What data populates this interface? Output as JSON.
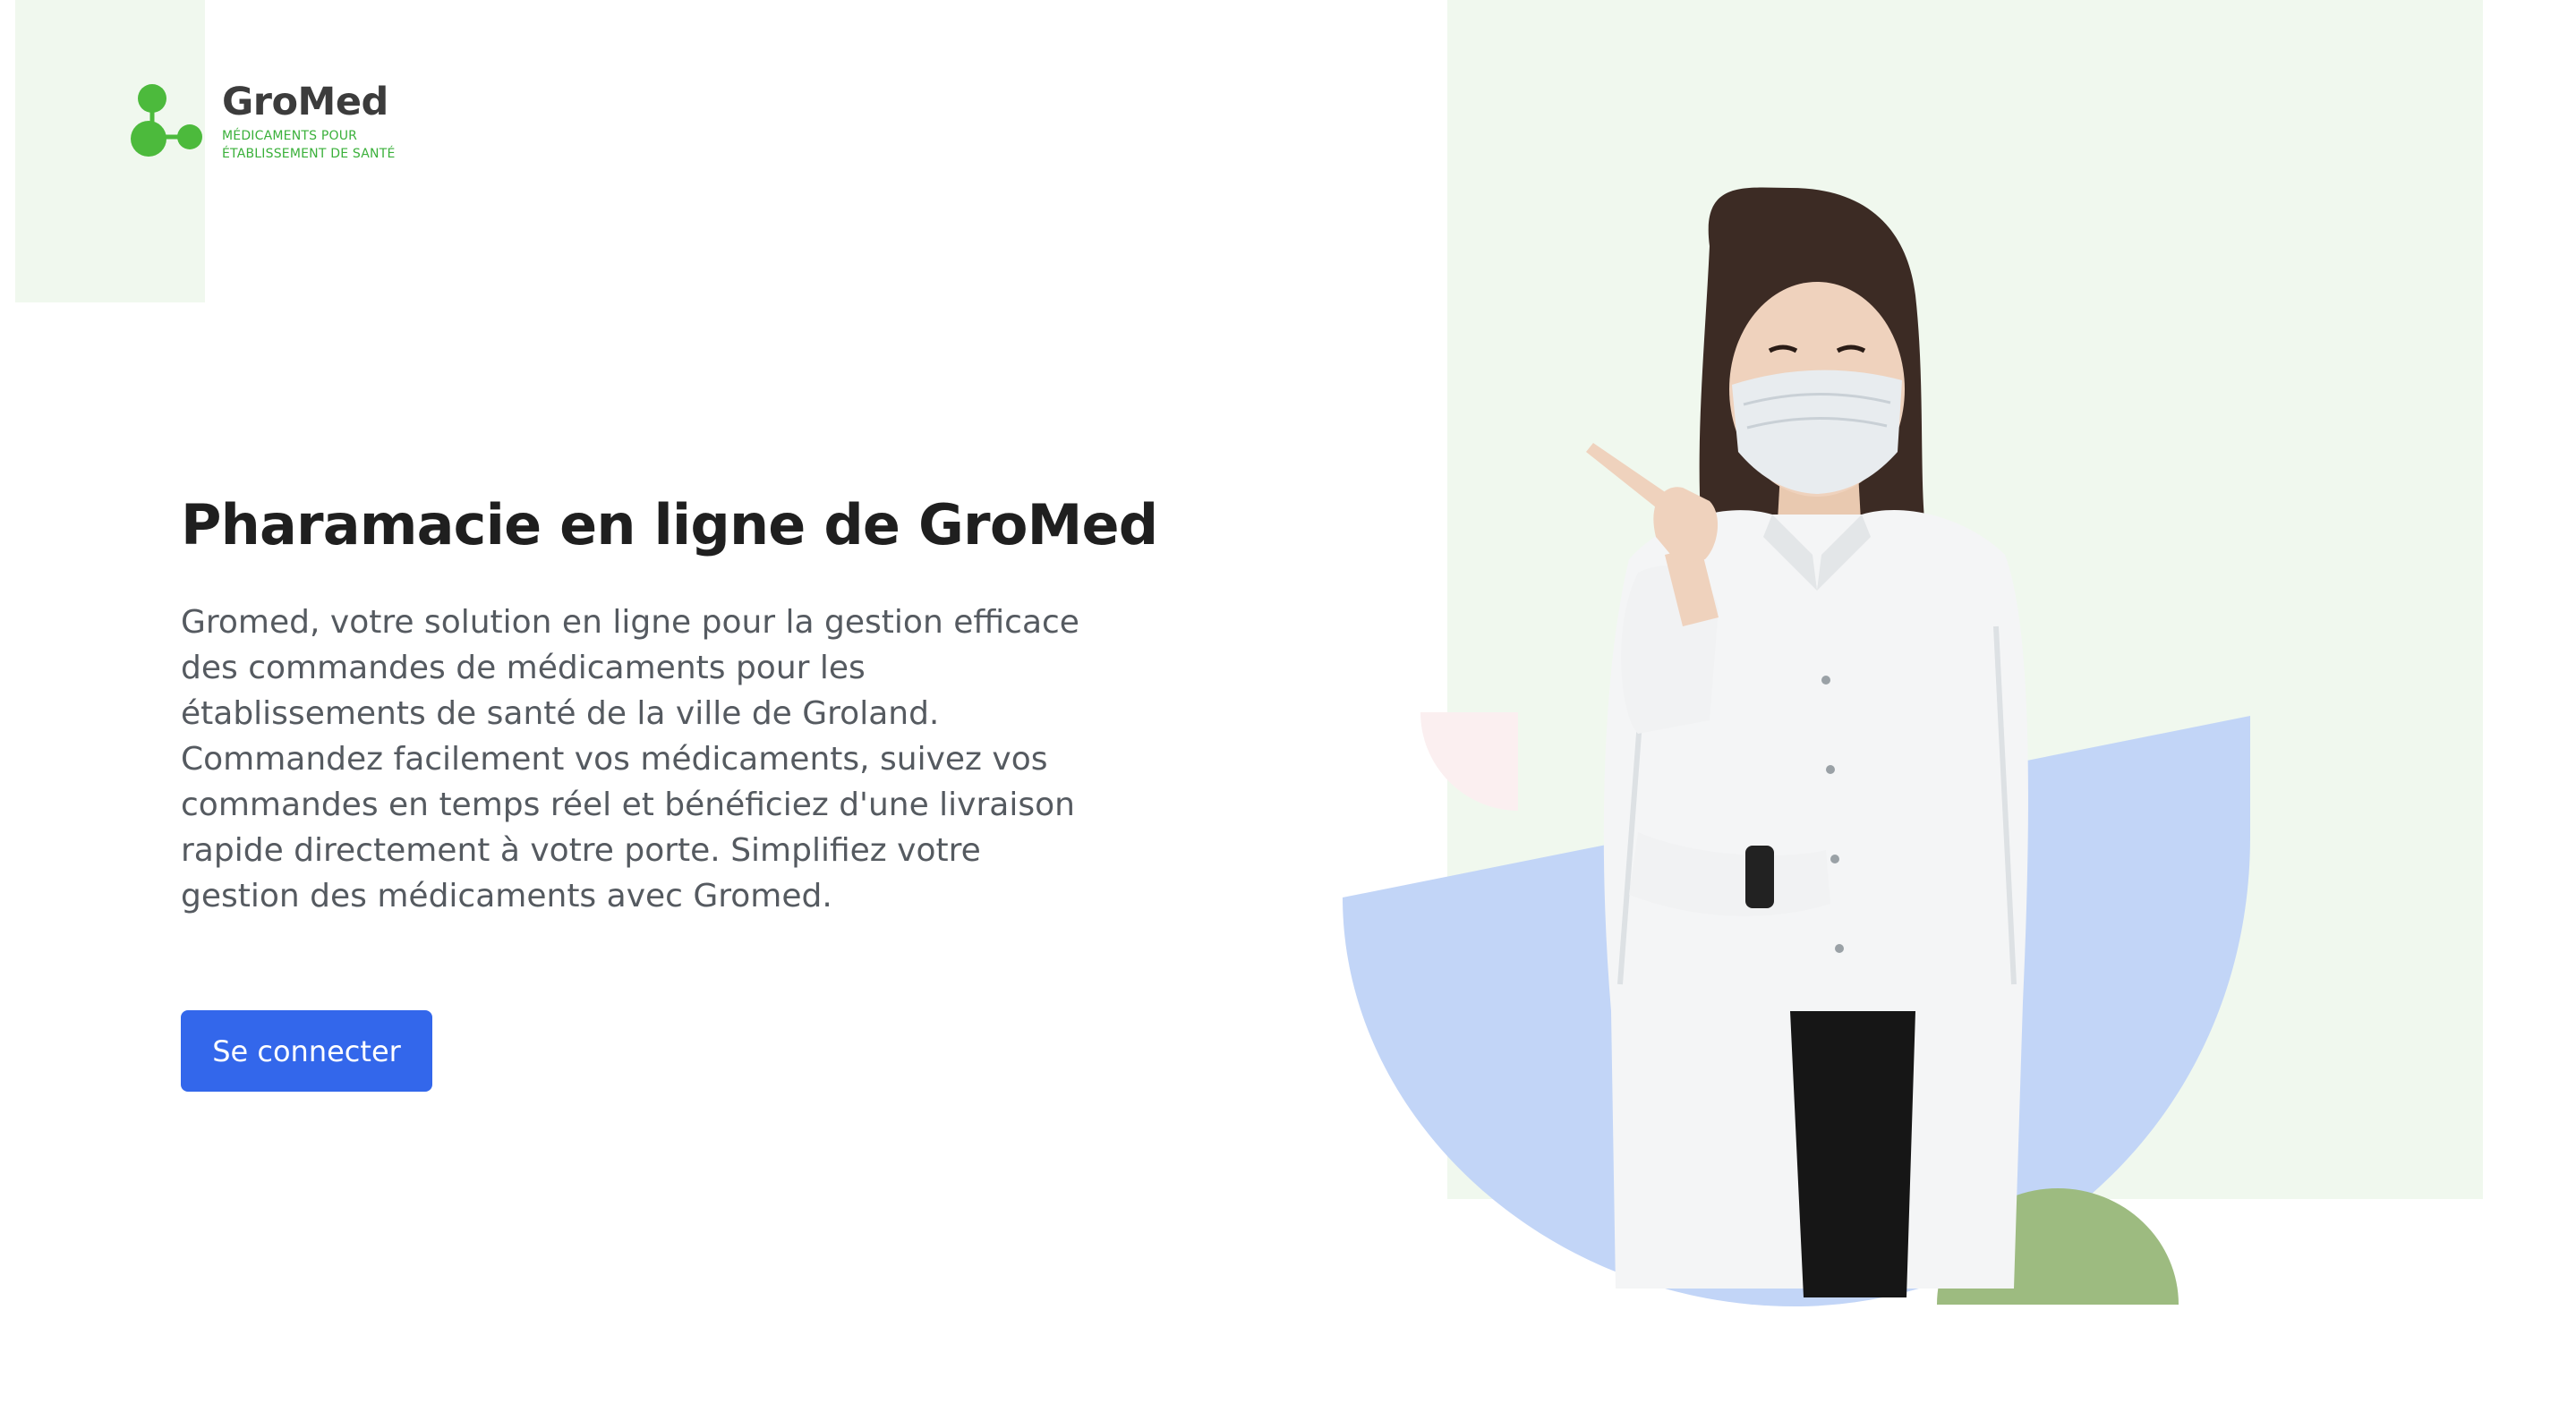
{
  "logo": {
    "name": "GroMed",
    "tagline_line1": "MÉDICAMENTS POUR",
    "tagline_line2": "ÉTABLISSEMENT DE SANTÉ",
    "icon": "molecule-icon"
  },
  "hero": {
    "title": "Pharamacie en ligne de GroMed",
    "description": "Gromed, votre solution en ligne pour la gestion efficace des commandes de médicaments pour les établissements de santé de la ville de Groland. Commandez facilement vos médicaments, suivez vos commandes en temps réel et bénéficiez d'une livraison rapide directement à votre porte. Simplifiez votre gestion des médicaments avec Gromed.",
    "login_label": "Se connecter"
  },
  "colors": {
    "brand_green": "#4cba3c",
    "light_green_bg": "#f0f8ee",
    "primary_button": "#3367eb",
    "illustration_blue": "#c2d5f7",
    "illustration_olive": "#9dbb80",
    "illustration_pink": "#fbeff0"
  }
}
